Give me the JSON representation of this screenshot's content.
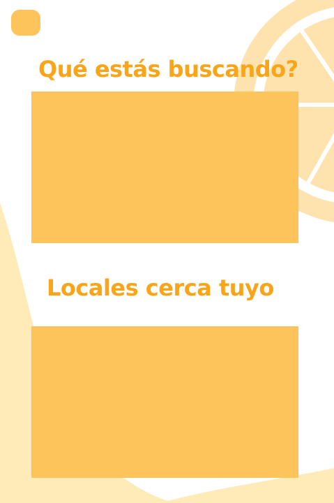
{
  "colors": {
    "accent_text": "#F9A51A",
    "card_fill": "#FEC45C",
    "menu_button": "#FEC45C",
    "background": "#FFFFFF",
    "decor_light": "#FEEBB7",
    "decor_ring": "#FEE3AE"
  },
  "menu": {
    "icon": "menu-square-icon"
  },
  "sections": {
    "search": {
      "title": "Qué estás buscando?"
    },
    "nearby": {
      "title": "Locales cerca tuyo"
    }
  }
}
